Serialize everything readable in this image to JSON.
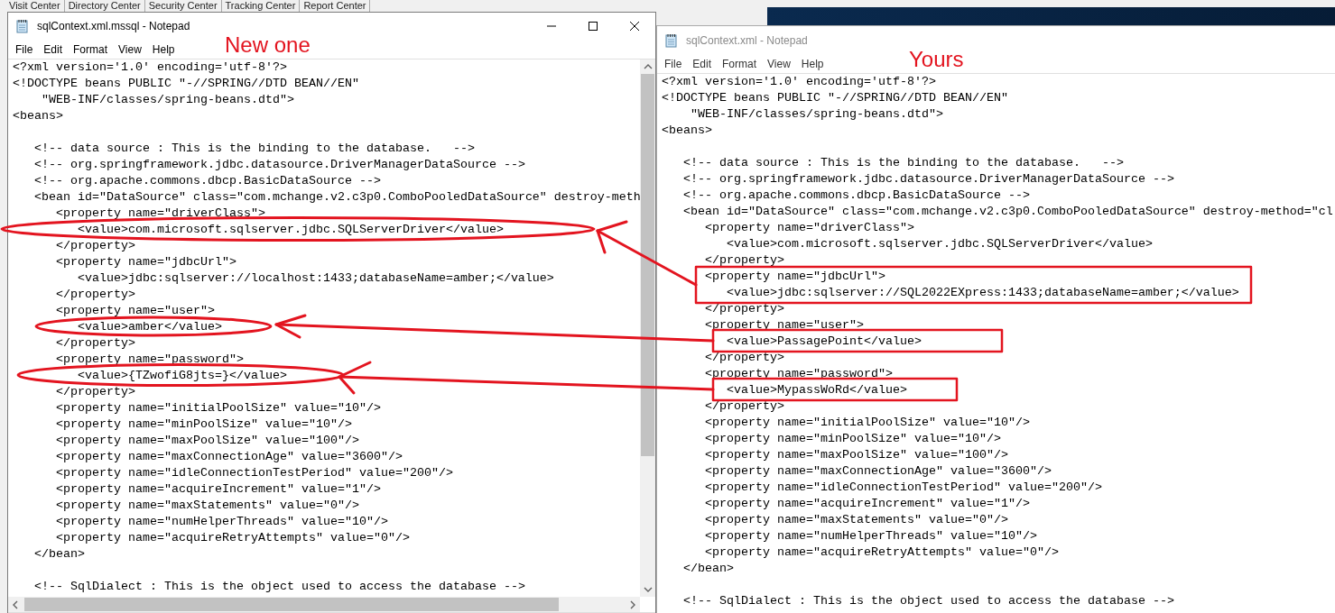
{
  "background_app": {
    "tabs": [
      "Visit Center",
      "Directory Center",
      "Security Center",
      "Tracking Center",
      "Report Center"
    ]
  },
  "windows": [
    {
      "title": "sqlContext.xml.mssql - Notepad",
      "active": true,
      "menu": [
        "File",
        "Edit",
        "Format",
        "View",
        "Help"
      ],
      "annotation_label": "New one",
      "blocks": [
        [
          "<?xml version='1.0' encoding='utf-8'?>",
          "<!DOCTYPE beans PUBLIC \"-//SPRING//DTD BEAN//EN\"",
          "    \"WEB-INF/classes/spring-beans.dtd\">",
          "<beans>"
        ],
        [
          "   <!-- data source : This is the binding to the database.   -->",
          "   <!-- org.springframework.jdbc.datasource.DriverManagerDataSource -->",
          "   <!-- org.apache.commons.dbcp.BasicDataSource -->",
          "   <bean id=\"DataSource\" class=\"com.mchange.v2.c3p0.ComboPooledDataSource\" destroy-meth",
          "      <property name=\"driverClass\">",
          "         <value>com.microsoft.sqlserver.jdbc.SQLServerDriver</value>",
          "      </property>",
          "      <property name=\"jdbcUrl\">",
          "         <value>jdbc:sqlserver://localhost:1433;databaseName=amber;</value>",
          "      </property>",
          "      <property name=\"user\">",
          "         <value>amber</value>",
          "      </property>",
          "      <property name=\"password\">",
          "         <value>{TZwofiG8jts=}</value>",
          "      </property>",
          "      <property name=\"initialPoolSize\" value=\"10\"/>",
          "      <property name=\"minPoolSize\" value=\"10\"/>",
          "      <property name=\"maxPoolSize\" value=\"100\"/>",
          "      <property name=\"maxConnectionAge\" value=\"3600\"/>",
          "      <property name=\"idleConnectionTestPeriod\" value=\"200\"/>",
          "      <property name=\"acquireIncrement\" value=\"1\"/>",
          "      <property name=\"maxStatements\" value=\"0\"/>",
          "      <property name=\"numHelperThreads\" value=\"10\"/>",
          "      <property name=\"acquireRetryAttempts\" value=\"0\"/>",
          "   </bean>"
        ],
        [
          "   <!-- SqlDialect : This is the object used to access the database -->"
        ]
      ]
    },
    {
      "title": "sqlContext.xml - Notepad",
      "active": false,
      "menu": [
        "File",
        "Edit",
        "Format",
        "View",
        "Help"
      ],
      "annotation_label": "Yours",
      "blocks": [
        [
          "<?xml version='1.0' encoding='utf-8'?>",
          "<!DOCTYPE beans PUBLIC \"-//SPRING//DTD BEAN//EN\"",
          "    \"WEB-INF/classes/spring-beans.dtd\">",
          "<beans>"
        ],
        [
          "   <!-- data source : This is the binding to the database.   -->",
          "   <!-- org.springframework.jdbc.datasource.DriverManagerDataSource -->",
          "   <!-- org.apache.commons.dbcp.BasicDataSource -->",
          "   <bean id=\"DataSource\" class=\"com.mchange.v2.c3p0.ComboPooledDataSource\" destroy-method=\"cl",
          "      <property name=\"driverClass\">",
          "         <value>com.microsoft.sqlserver.jdbc.SQLServerDriver</value>",
          "      </property>",
          "      <property name=\"jdbcUrl\">",
          "         <value>jdbc:sqlserver://SQL2022EXpress:1433;databaseName=amber;</value>",
          "      </property>",
          "      <property name=\"user\">",
          "         <value>PassagePoint</value>",
          "      </property>",
          "      <property name=\"password\">",
          "         <value>MypassWoRd</value>",
          "      </property>",
          "      <property name=\"initialPoolSize\" value=\"10\"/>",
          "      <property name=\"minPoolSize\" value=\"10\"/>",
          "      <property name=\"maxPoolSize\" value=\"100\"/>",
          "      <property name=\"maxConnectionAge\" value=\"3600\"/>",
          "      <property name=\"idleConnectionTestPeriod\" value=\"200\"/>",
          "      <property name=\"acquireIncrement\" value=\"1\"/>",
          "      <property name=\"maxStatements\" value=\"0\"/>",
          "      <property name=\"numHelperThreads\" value=\"10\"/>",
          "      <property name=\"acquireRetryAttempts\" value=\"0\"/>",
          "   </bean>"
        ],
        [
          "   <!-- SqlDialect : This is the object used to access the database -->"
        ]
      ]
    }
  ]
}
